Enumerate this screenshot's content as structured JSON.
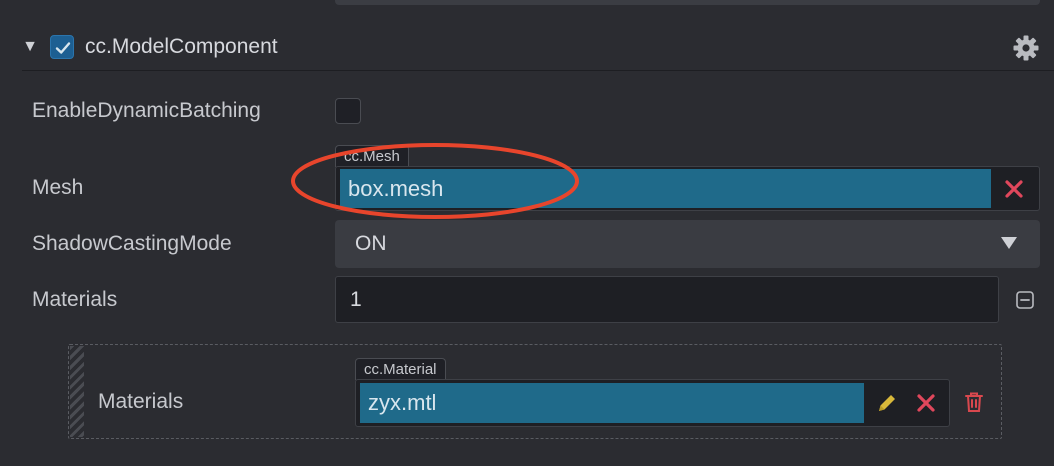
{
  "component": {
    "title": "cc.ModelComponent",
    "enabled": true
  },
  "properties": {
    "enable_dynamic_batching": {
      "label": "EnableDynamicBatching",
      "checked": false
    },
    "mesh": {
      "label": "Mesh",
      "asset_type": "cc.Mesh",
      "value": "box.mesh"
    },
    "shadow_casting_mode": {
      "label": "ShadowCastingMode",
      "value": "ON"
    },
    "materials": {
      "label": "Materials",
      "count": "1",
      "items": [
        {
          "label": "Materials",
          "asset_type": "cc.Material",
          "value": "zyx.mtl"
        }
      ]
    }
  },
  "icons": {
    "toggle": "triangle-down-icon",
    "settings": "gear-icon",
    "clear": "close-icon",
    "edit": "pencil-icon",
    "delete": "trash-icon",
    "collapse": "minus-square-icon",
    "dropdown": "caret-down-icon"
  },
  "colors": {
    "background": "#2b2c31",
    "asset_value_bg": "#1f6a8a",
    "checkbox_checked": "#1d5f92",
    "clear_icon": "#e0475c",
    "edit_icon": "#d8b83a",
    "delete_icon": "#d9484e",
    "annotation_ellipse": "#e8452c"
  }
}
